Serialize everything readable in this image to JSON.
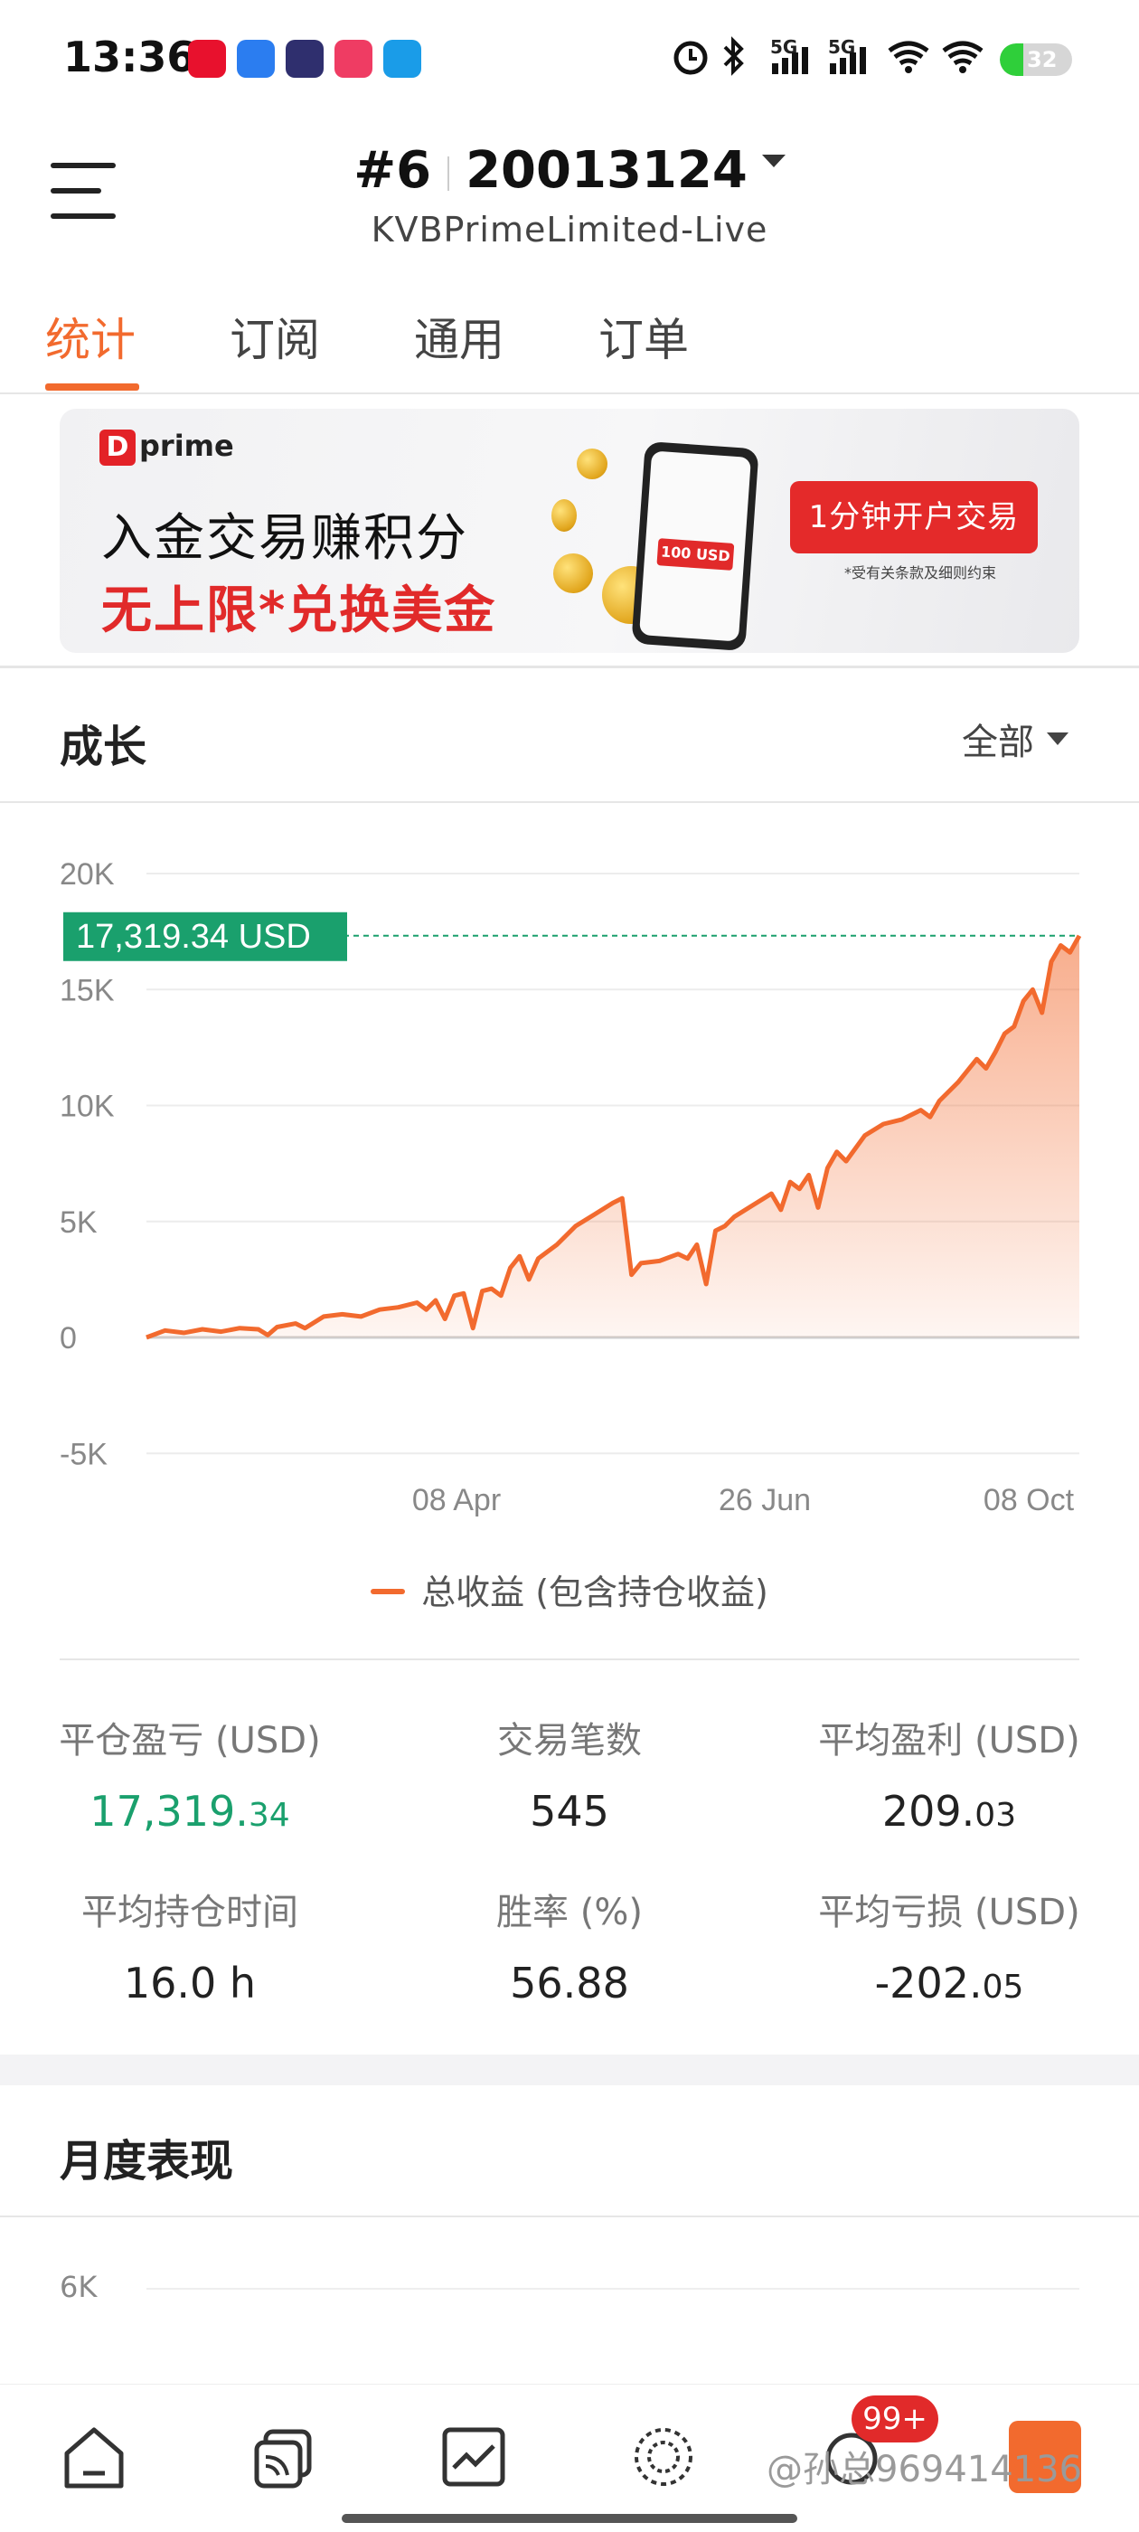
{
  "status_bar": {
    "time": "13:36",
    "battery": "32",
    "network_labels": [
      "5G",
      "5G"
    ],
    "app_icons": [
      "tmall-icon",
      "browser-icon",
      "video-icon",
      "douyin-icon",
      "eleme-icon"
    ]
  },
  "header": {
    "account_prefix": "#6",
    "account_number": "20013124",
    "server": "KVBPrimeLimited-Live"
  },
  "tabs": [
    {
      "label": "统计",
      "active": true
    },
    {
      "label": "订阅",
      "active": false
    },
    {
      "label": "通用",
      "active": false
    },
    {
      "label": "订单",
      "active": false
    }
  ],
  "banner": {
    "brand": "prime",
    "line1": "入金交易赚积分",
    "line2": "无上限*兑换美金",
    "phone_tag": "100 USD",
    "cta": "1分钟开户交易",
    "note": "*受有关条款及细则约束"
  },
  "growth": {
    "title": "成长",
    "range_label": "全部",
    "legend": "总收益 (包含持仓收益)",
    "current_value_label": "17,319.34 USD"
  },
  "chart_data": {
    "type": "area",
    "title": "",
    "xlabel": "",
    "ylabel": "",
    "ylim": [
      -5000,
      20000
    ],
    "yticks": [
      "20K",
      "15K",
      "10K",
      "5K",
      "0",
      "-5K"
    ],
    "ytick_values": [
      20000,
      15000,
      10000,
      5000,
      0,
      -5000
    ],
    "xticks": [
      "08 Apr",
      "26 Jun",
      "08 Oct"
    ],
    "grid": true,
    "color": "#f26a2e",
    "reference_line": {
      "value": 17319.34,
      "label": "17,319.34 USD",
      "color": "#1aa06d"
    },
    "series": [
      {
        "name": "总收益 (包含持仓收益)",
        "x_range_start": 0,
        "x_range_end": 100,
        "points": [
          [
            0,
            0
          ],
          [
            2,
            300
          ],
          [
            4,
            200
          ],
          [
            6,
            350
          ],
          [
            8,
            250
          ],
          [
            10,
            400
          ],
          [
            12,
            350
          ],
          [
            13,
            100
          ],
          [
            14,
            450
          ],
          [
            16,
            600
          ],
          [
            17,
            400
          ],
          [
            19,
            900
          ],
          [
            21,
            1000
          ],
          [
            23,
            900
          ],
          [
            25,
            1200
          ],
          [
            27,
            1300
          ],
          [
            29,
            1500
          ],
          [
            30,
            1200
          ],
          [
            31,
            1600
          ],
          [
            32,
            800
          ],
          [
            33,
            1800
          ],
          [
            34,
            1900
          ],
          [
            35,
            400
          ],
          [
            36,
            2000
          ],
          [
            37,
            2100
          ],
          [
            38,
            1800
          ],
          [
            39,
            3000
          ],
          [
            40,
            3500
          ],
          [
            41,
            2500
          ],
          [
            42,
            3400
          ],
          [
            44,
            4000
          ],
          [
            46,
            4800
          ],
          [
            48,
            5300
          ],
          [
            50,
            5800
          ],
          [
            51,
            6000
          ],
          [
            52,
            2700
          ],
          [
            53,
            3200
          ],
          [
            55,
            3300
          ],
          [
            57,
            3600
          ],
          [
            58,
            3400
          ],
          [
            59,
            4000
          ],
          [
            60,
            2300
          ],
          [
            61,
            4600
          ],
          [
            62,
            4800
          ],
          [
            63,
            5200
          ],
          [
            65,
            5700
          ],
          [
            67,
            6200
          ],
          [
            68,
            5500
          ],
          [
            69,
            6700
          ],
          [
            70,
            6400
          ],
          [
            71,
            7000
          ],
          [
            72,
            5600
          ],
          [
            73,
            7300
          ],
          [
            74,
            8000
          ],
          [
            75,
            7600
          ],
          [
            77,
            8700
          ],
          [
            79,
            9200
          ],
          [
            81,
            9400
          ],
          [
            83,
            9800
          ],
          [
            84,
            9500
          ],
          [
            85,
            10200
          ],
          [
            87,
            11000
          ],
          [
            89,
            12000
          ],
          [
            90,
            11600
          ],
          [
            91,
            12300
          ],
          [
            92,
            13100
          ],
          [
            93,
            13400
          ],
          [
            94,
            14500
          ],
          [
            95,
            15000
          ],
          [
            96,
            14000
          ],
          [
            97,
            16200
          ],
          [
            98,
            16900
          ],
          [
            99,
            16600
          ],
          [
            100,
            17319.34
          ]
        ]
      }
    ]
  },
  "stats": [
    {
      "label": "平仓盈亏 (USD)",
      "value_main": "17,319.",
      "value_small": "34",
      "highlight": true
    },
    {
      "label": "交易笔数",
      "value_main": "545",
      "value_small": "",
      "highlight": false
    },
    {
      "label": "平均盈利 (USD)",
      "value_main": "209.",
      "value_small": "03",
      "highlight": false
    },
    {
      "label": "平均持仓时间",
      "value_main": "16.0 h",
      "value_small": "",
      "highlight": false
    },
    {
      "label": "胜率 (%)",
      "value_main": "56.88",
      "value_small": "",
      "highlight": false
    },
    {
      "label": "平均亏损 (USD)",
      "value_main": "-202.",
      "value_small": "05",
      "highlight": false
    }
  ],
  "monthly": {
    "title": "月度表现",
    "first_tick": "6K"
  },
  "bottom_nav": {
    "items": [
      "home-icon",
      "copy-trading-icon",
      "chart-icon",
      "discover-icon",
      "messages-icon",
      "profile-icon"
    ],
    "badge": "99+"
  },
  "watermark": "@孙总969414136"
}
